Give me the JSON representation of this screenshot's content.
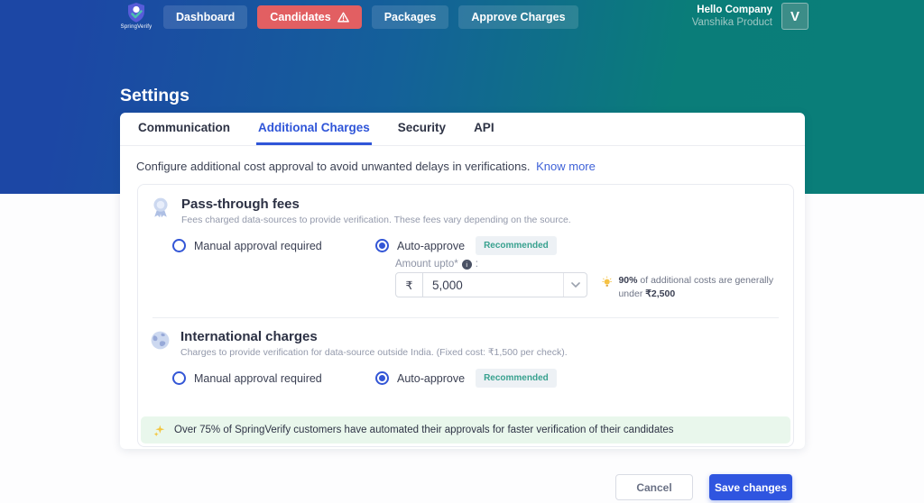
{
  "brand": {
    "wordmark": "SpringVerify"
  },
  "navbar": {
    "items": [
      {
        "label": "Dashboard"
      },
      {
        "label": "Candidates"
      },
      {
        "label": "Packages"
      },
      {
        "label": "Approve Charges"
      }
    ],
    "user": {
      "company": "Hello Company",
      "name": "Vanshika Product",
      "avatar_initial": "V"
    }
  },
  "page": {
    "title": "Settings"
  },
  "tabs": [
    {
      "label": "Communication"
    },
    {
      "label": "Additional Charges"
    },
    {
      "label": "Security"
    },
    {
      "label": "API"
    }
  ],
  "intro": {
    "text": "Configure additional cost approval to avoid unwanted delays in verifications.",
    "link": "Know more"
  },
  "sections": [
    {
      "title": "Pass-through fees",
      "subtitle": "Fees charged data-sources to provide verification. These fees vary depending on the source.",
      "manual_label": "Manual approval required",
      "auto_label": "Auto-approve",
      "badge": "Recommended",
      "selected": "auto",
      "amount": {
        "label": "Amount upto*",
        "suffix": ":",
        "currency": "₹",
        "value": "5,000"
      },
      "tip": {
        "highlight": "90%",
        "text": " of additional costs are generally under ",
        "amount": "₹2,500"
      }
    },
    {
      "title": "International charges",
      "subtitle": "Charges to provide verification for data-source outside India. (Fixed cost: ₹1,500 per check).",
      "manual_label": "Manual approval required",
      "auto_label": "Auto-approve",
      "badge": "Recommended",
      "selected": "auto"
    }
  ],
  "banner": {
    "text": "Over 75% of SpringVerify customers have automated their approvals for faster verification of their candidates"
  },
  "footer": {
    "cancel_label": "Cancel",
    "save_label": "Save changes"
  },
  "colors": {
    "accent_blue": "#2f55d8",
    "hero_blue": "#1c47a5",
    "hero_teal": "#0a7d79",
    "alert_red": "#e25f62",
    "badge_teal": "#38a18f",
    "banner_green_bg": "#e9f7ec",
    "save_blue": "#2f55e0"
  }
}
